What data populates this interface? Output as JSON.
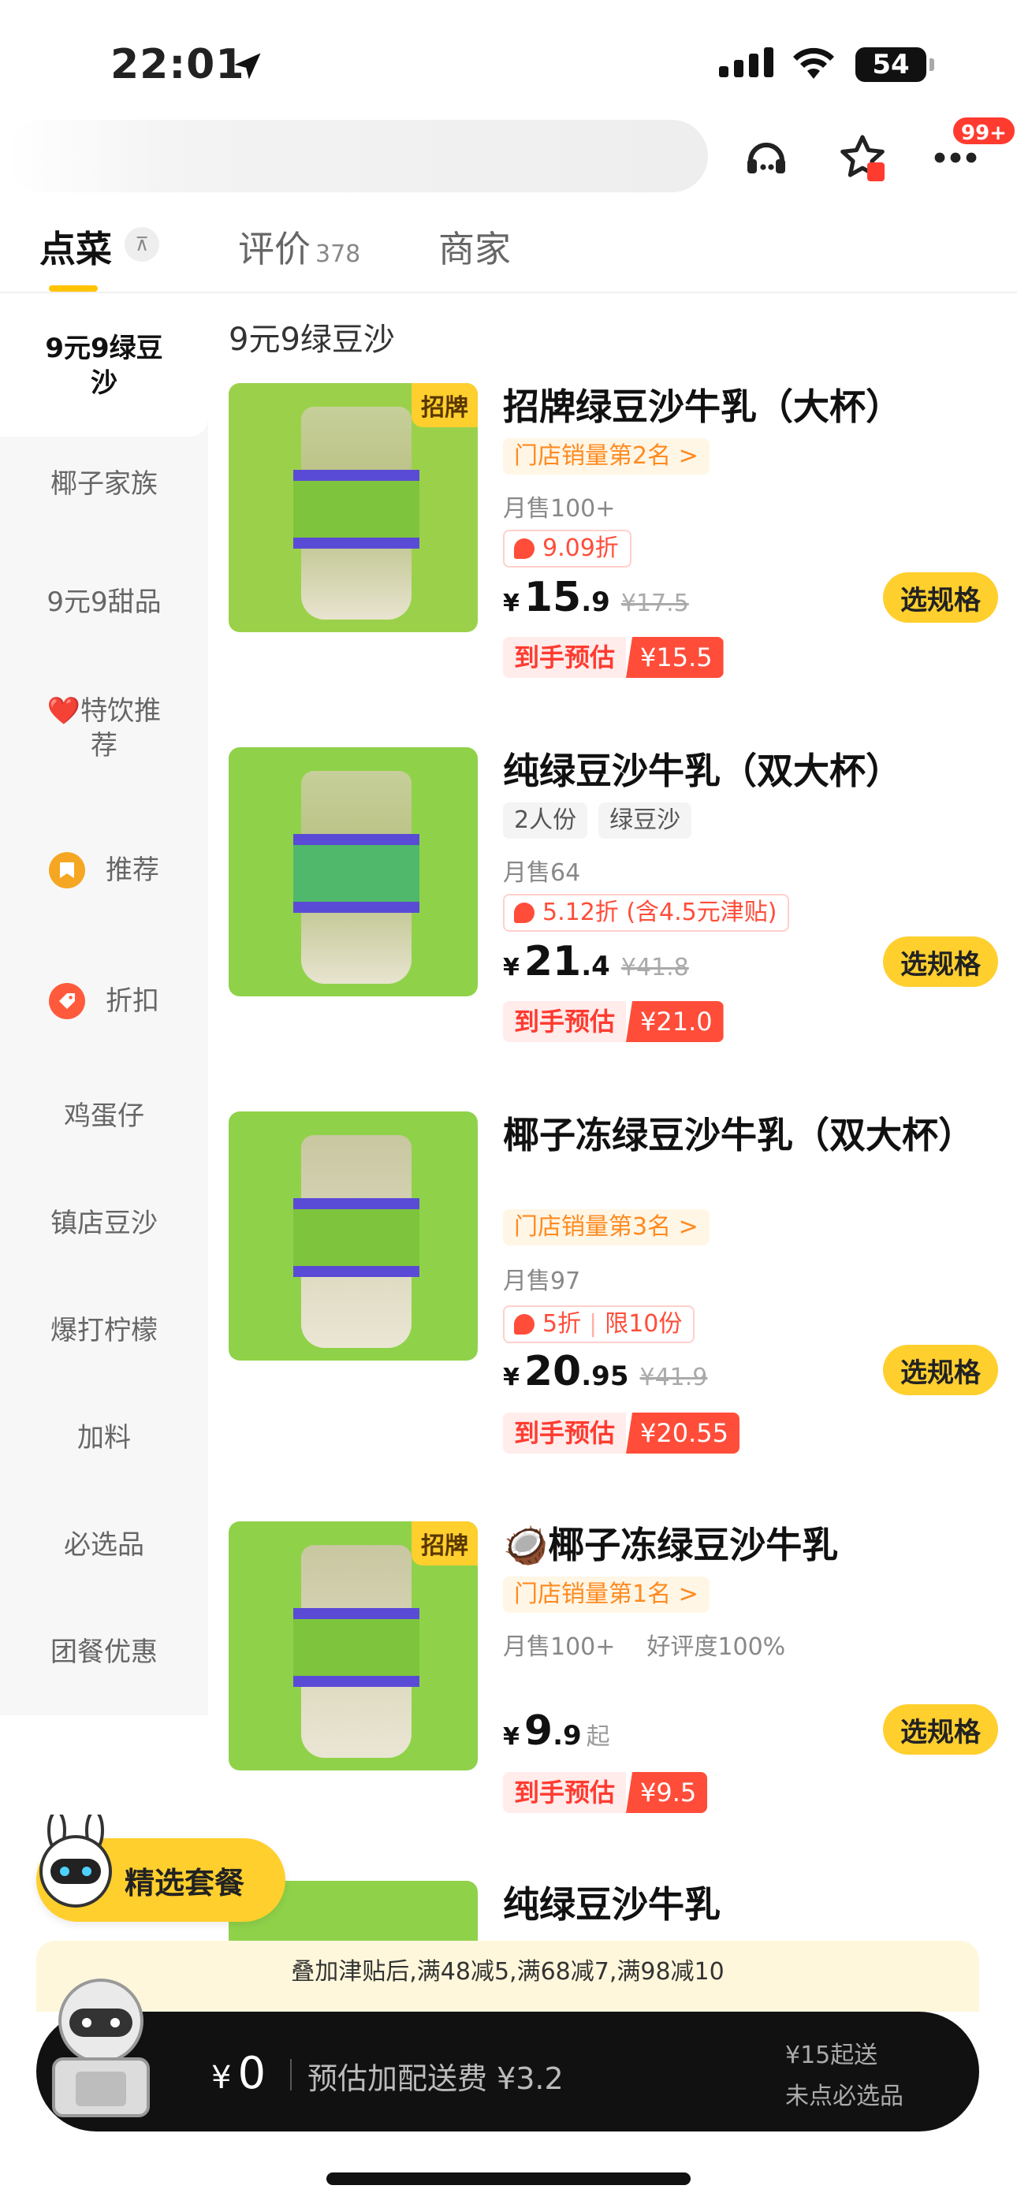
{
  "status_bar": {
    "time": "22:01",
    "battery": "54"
  },
  "header": {
    "notification_badge": "99+"
  },
  "tabs": [
    {
      "label": "点菜",
      "count": ""
    },
    {
      "label": "评价",
      "count": "378"
    },
    {
      "label": "商家",
      "count": ""
    }
  ],
  "tab_pin_glyph": "⊼",
  "sidebar": {
    "items": [
      {
        "label": "9元9绿豆沙"
      },
      {
        "label": "椰子家族"
      },
      {
        "label": "9元9甜品"
      },
      {
        "label": "❤️特饮推荐"
      },
      {
        "label": "推荐"
      },
      {
        "label": "折扣"
      },
      {
        "label": "鸡蛋仔"
      },
      {
        "label": "镇店豆沙"
      },
      {
        "label": "爆打柠檬"
      },
      {
        "label": "加料"
      },
      {
        "label": "必选品"
      },
      {
        "label": "团餐优惠"
      }
    ]
  },
  "section_title": "9元9绿豆沙",
  "products": [
    {
      "tag": "招牌",
      "name": "招牌绿豆沙牛乳（大杯）",
      "rank": "门店销量第2名 >",
      "sales": "月售100+",
      "discount": "9.09折",
      "discount_extra": "",
      "currency": "¥",
      "price_int": "15",
      "price_dec": ".9",
      "price_old": "¥17.5",
      "button": "选规格",
      "est_label": "到手预估",
      "est_value": "¥15.5"
    },
    {
      "tag": "",
      "name": "纯绿豆沙牛乳（双大杯）",
      "chips": [
        "2人份",
        "绿豆沙"
      ],
      "sales": "月售64",
      "discount": "5.12折 (含4.5元津贴)",
      "currency": "¥",
      "price_int": "21",
      "price_dec": ".4",
      "price_old": "¥41.8",
      "button": "选规格",
      "est_label": "到手预估",
      "est_value": "¥21.0"
    },
    {
      "tag": "",
      "name": "椰子冻绿豆沙牛乳（双大杯）",
      "rank": "门店销量第3名 >",
      "sales": "月售97",
      "discount": "5折",
      "discount_extra": "限10份",
      "currency": "¥",
      "price_int": "20",
      "price_dec": ".95",
      "price_old": "¥41.9",
      "button": "选规格",
      "est_label": "到手预估",
      "est_value": "¥20.55"
    },
    {
      "tag": "招牌",
      "name": "🥥椰子冻绿豆沙牛乳",
      "rank": "门店销量第1名 >",
      "sales": "月售100+",
      "rating": "好评度100%",
      "currency": "¥",
      "price_int": "9",
      "price_dec": ".9",
      "price_suffix": "起",
      "button": "选规格",
      "est_label": "到手预估",
      "est_value": "¥9.5"
    },
    {
      "tag": "",
      "name": "纯绿豆沙牛乳"
    }
  ],
  "combo_button": "精选套餐",
  "promo_strip": "叠加津贴后,满48减5,满68减7,满98减10",
  "cart": {
    "currency": "¥",
    "amount": "0",
    "delivery_fee": "预估加配送费 ¥3.2",
    "min_order": "¥15起送",
    "required_note": "未点必选品"
  },
  "colors": {
    "accent": "#ffcf2e",
    "discount_red": "#ff4d3a",
    "rank_orange": "#ff8a1f"
  }
}
